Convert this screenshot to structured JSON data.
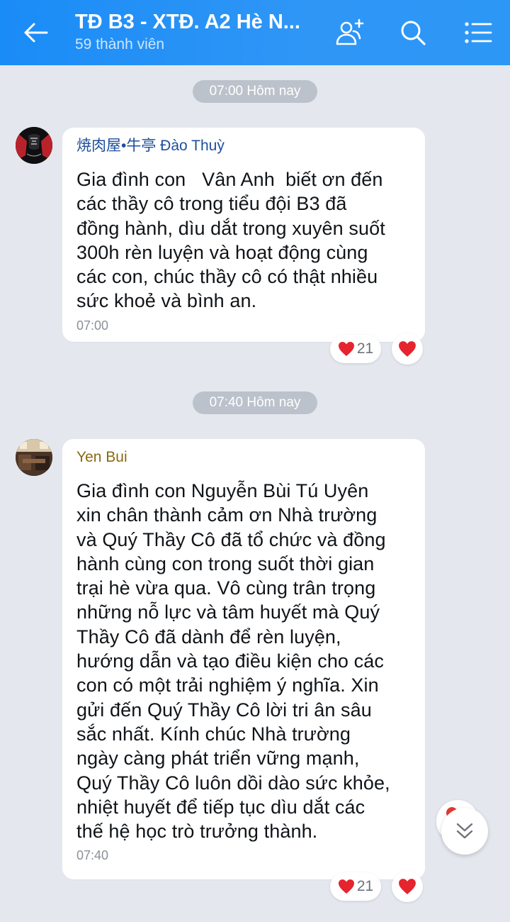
{
  "header": {
    "title": "TĐ B3 - XTĐ. A2 Hè N...",
    "subtitle": "59 thành viên",
    "background": "#2394f6"
  },
  "messages": [
    {
      "time_divider": "07:00 Hôm nay",
      "sender": "焼肉屋•牛亭 Đào Thuỳ",
      "sender_color": "#1d4f9b",
      "text": "Gia đình con   Vân Anh  biết ơn đến\ncác thầy cô trong tiểu đội B3 đã\nđồng hành, dìu dắt trong xuyên suốt\n300h rèn luyện và hoạt động cùng\ncác con, chúc thầy cô có thật nhiều\nsức khoẻ và bình an.",
      "time": "07:00",
      "reaction_count": "21",
      "reaction_icon": "heart-icon"
    },
    {
      "time_divider": "07:40 Hôm nay",
      "sender": "Yen Bui",
      "sender_color": "#8a6a12",
      "text": "Gia đình con Nguyễn Bùi Tú Uyên\nxin chân thành cảm ơn Nhà trường\nvà Quý Thầy Cô đã tổ chức và đồng\nhành cùng con trong suốt thời gian\ntrại hè vừa qua. Vô cùng trân trọng\nnhững nỗ lực và tâm huyết mà Quý\nThầy Cô đã dành để rèn luyện,\nhướng dẫn và tạo điều kiện cho các\ncon có một trải nghiệm ý nghĩa. Xin\ngửi đến Quý Thầy Cô lời tri ân sâu\nsắc nhất. Kính chúc Nhà trường\nngày càng phát triển vững mạnh,\nQuý Thầy Cô luôn dồi dào sức khỏe,\nnhiệt huyết để tiếp tục dìu dắt các\nthế hệ học trò trưởng thành.",
      "time": "07:40",
      "reaction_count": "21",
      "reaction_icon": "heart-icon"
    }
  ],
  "colors": {
    "chat_background": "#e4e8ee",
    "time_pill": "#bcc2cb",
    "heart": "#e5242e"
  }
}
